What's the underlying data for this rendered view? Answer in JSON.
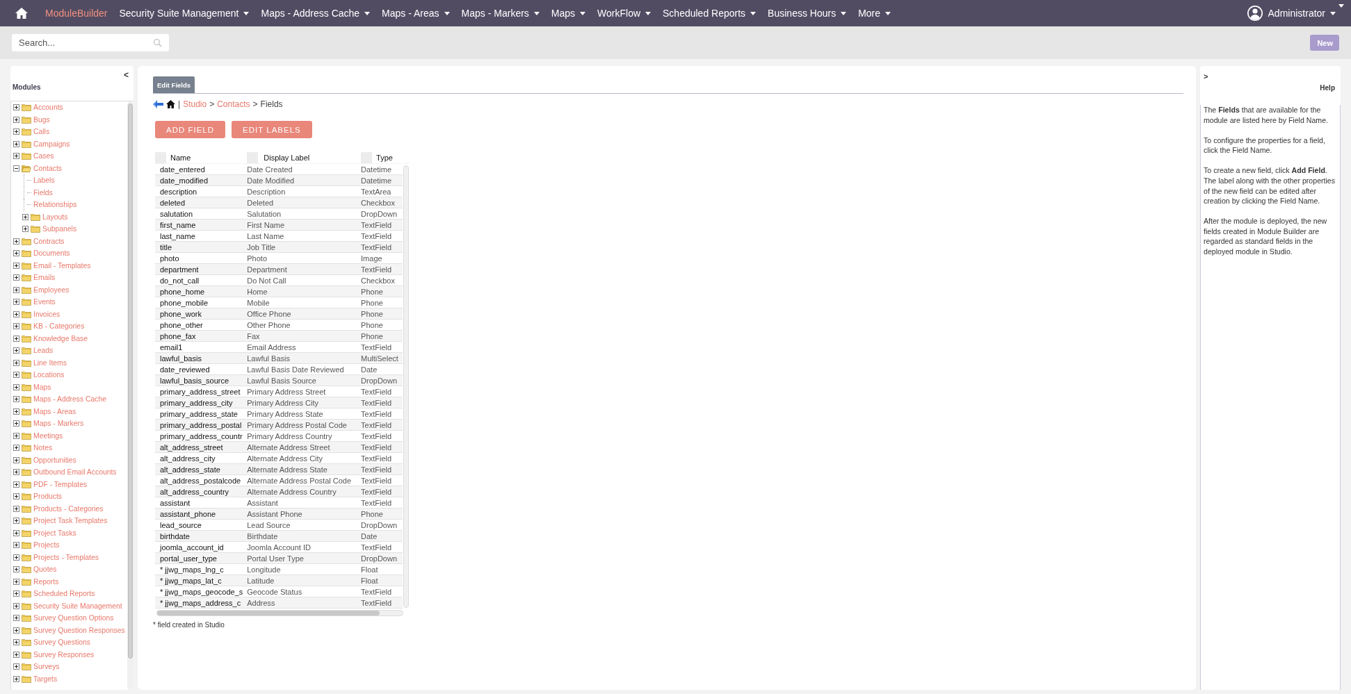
{
  "top_nav": {
    "items": [
      {
        "label": "ModuleBuilder",
        "selected": true,
        "dropdown": false
      },
      {
        "label": "Security Suite Management",
        "selected": false,
        "dropdown": true
      },
      {
        "label": "Maps - Address Cache",
        "selected": false,
        "dropdown": true
      },
      {
        "label": "Maps - Areas",
        "selected": false,
        "dropdown": true
      },
      {
        "label": "Maps - Markers",
        "selected": false,
        "dropdown": true
      },
      {
        "label": "Maps",
        "selected": false,
        "dropdown": true
      },
      {
        "label": "WorkFlow",
        "selected": false,
        "dropdown": true
      },
      {
        "label": "Scheduled Reports",
        "selected": false,
        "dropdown": true
      },
      {
        "label": "Business Hours",
        "selected": false,
        "dropdown": true
      },
      {
        "label": "More",
        "selected": false,
        "dropdown": true
      }
    ],
    "user": {
      "name": "Administrator"
    }
  },
  "search": {
    "placeholder": "Search..."
  },
  "new_button": {
    "label": "New"
  },
  "modules_panel": {
    "collapse": "<",
    "title": "Modules",
    "tree": [
      {
        "label": "Accounts",
        "kind": "folder",
        "expanded": false
      },
      {
        "label": "Bugs",
        "kind": "folder",
        "expanded": false
      },
      {
        "label": "Calls",
        "kind": "folder",
        "expanded": false
      },
      {
        "label": "Campaigns",
        "kind": "folder",
        "expanded": false
      },
      {
        "label": "Cases",
        "kind": "folder",
        "expanded": false
      },
      {
        "label": "Contacts",
        "kind": "folder",
        "expanded": true,
        "children": [
          {
            "label": "Labels",
            "kind": "leaf"
          },
          {
            "label": "Fields",
            "kind": "leaf"
          },
          {
            "label": "Relationships",
            "kind": "leaf"
          },
          {
            "label": "Layouts",
            "kind": "folder",
            "expanded": false
          },
          {
            "label": "Subpanels",
            "kind": "folder",
            "expanded": false
          }
        ]
      },
      {
        "label": "Contracts",
        "kind": "folder",
        "expanded": false
      },
      {
        "label": "Documents",
        "kind": "folder",
        "expanded": false
      },
      {
        "label": "Email - Templates",
        "kind": "folder",
        "expanded": false
      },
      {
        "label": "Emails",
        "kind": "folder",
        "expanded": false
      },
      {
        "label": "Employees",
        "kind": "folder",
        "expanded": false
      },
      {
        "label": "Events",
        "kind": "folder",
        "expanded": false
      },
      {
        "label": "Invoices",
        "kind": "folder",
        "expanded": false
      },
      {
        "label": "KB - Categories",
        "kind": "folder",
        "expanded": false
      },
      {
        "label": "Knowledge Base",
        "kind": "folder",
        "expanded": false
      },
      {
        "label": "Leads",
        "kind": "folder",
        "expanded": false
      },
      {
        "label": "Line Items",
        "kind": "folder",
        "expanded": false
      },
      {
        "label": "Locations",
        "kind": "folder",
        "expanded": false
      },
      {
        "label": "Maps",
        "kind": "folder",
        "expanded": false
      },
      {
        "label": "Maps - Address Cache",
        "kind": "folder",
        "expanded": false
      },
      {
        "label": "Maps - Areas",
        "kind": "folder",
        "expanded": false
      },
      {
        "label": "Maps - Markers",
        "kind": "folder",
        "expanded": false
      },
      {
        "label": "Meetings",
        "kind": "folder",
        "expanded": false
      },
      {
        "label": "Notes",
        "kind": "folder",
        "expanded": false
      },
      {
        "label": "Opportunities",
        "kind": "folder",
        "expanded": false
      },
      {
        "label": "Outbound Email Accounts",
        "kind": "folder",
        "expanded": false
      },
      {
        "label": "PDF - Templates",
        "kind": "folder",
        "expanded": false
      },
      {
        "label": "Products",
        "kind": "folder",
        "expanded": false
      },
      {
        "label": "Products - Categories",
        "kind": "folder",
        "expanded": false
      },
      {
        "label": "Project Task Templates",
        "kind": "folder",
        "expanded": false
      },
      {
        "label": "Project Tasks",
        "kind": "folder",
        "expanded": false
      },
      {
        "label": "Projects",
        "kind": "folder",
        "expanded": false
      },
      {
        "label": "Projects - Templates",
        "kind": "folder",
        "expanded": false
      },
      {
        "label": "Quotes",
        "kind": "folder",
        "expanded": false
      },
      {
        "label": "Reports",
        "kind": "folder",
        "expanded": false
      },
      {
        "label": "Scheduled Reports",
        "kind": "folder",
        "expanded": false
      },
      {
        "label": "Security Suite Management",
        "kind": "folder",
        "expanded": false
      },
      {
        "label": "Survey Question Options",
        "kind": "folder",
        "expanded": false
      },
      {
        "label": "Survey Question Responses",
        "kind": "folder",
        "expanded": false
      },
      {
        "label": "Survey Questions",
        "kind": "folder",
        "expanded": false
      },
      {
        "label": "Survey Responses",
        "kind": "folder",
        "expanded": false
      },
      {
        "label": "Surveys",
        "kind": "folder",
        "expanded": false
      },
      {
        "label": "Targets",
        "kind": "folder",
        "expanded": false
      }
    ]
  },
  "editor": {
    "tabs": [
      {
        "label": "Edit Fields",
        "selected": true
      }
    ],
    "breadcrumb": [
      {
        "text": "|",
        "kind": "separator"
      },
      {
        "text": "Studio",
        "kind": "link"
      },
      {
        "text": ">",
        "kind": "separator"
      },
      {
        "text": "Contacts",
        "kind": "link"
      },
      {
        "text": ">",
        "kind": "separator"
      },
      {
        "text": "Fields",
        "kind": "current"
      }
    ],
    "buttons": [
      "ADD FIELD",
      "EDIT LABELS"
    ],
    "table": {
      "columns": [
        "Name",
        "Display Label",
        "Type"
      ],
      "rows": [
        [
          "date_entered",
          "Date Created",
          "Datetime"
        ],
        [
          "date_modified",
          "Date Modified",
          "Datetime"
        ],
        [
          "description",
          "Description",
          "TextArea"
        ],
        [
          "deleted",
          "Deleted",
          "Checkbox"
        ],
        [
          "salutation",
          "Salutation",
          "DropDown"
        ],
        [
          "first_name",
          "First Name",
          "TextField"
        ],
        [
          "last_name",
          "Last Name",
          "TextField"
        ],
        [
          "title",
          "Job Title",
          "TextField"
        ],
        [
          "photo",
          "Photo",
          "Image"
        ],
        [
          "department",
          "Department",
          "TextField"
        ],
        [
          "do_not_call",
          "Do Not Call",
          "Checkbox"
        ],
        [
          "phone_home",
          "Home",
          "Phone"
        ],
        [
          "phone_mobile",
          "Mobile",
          "Phone"
        ],
        [
          "phone_work",
          "Office Phone",
          "Phone"
        ],
        [
          "phone_other",
          "Other Phone",
          "Phone"
        ],
        [
          "phone_fax",
          "Fax",
          "Phone"
        ],
        [
          "email1",
          "Email Address",
          "TextField"
        ],
        [
          "lawful_basis",
          "Lawful Basis",
          "MultiSelect"
        ],
        [
          "date_reviewed",
          "Lawful Basis Date Reviewed",
          "Date"
        ],
        [
          "lawful_basis_source",
          "Lawful Basis Source",
          "DropDown"
        ],
        [
          "primary_address_street",
          "Primary Address Street",
          "TextField"
        ],
        [
          "primary_address_city",
          "Primary Address City",
          "TextField"
        ],
        [
          "primary_address_state",
          "Primary Address State",
          "TextField"
        ],
        [
          "primary_address_postal",
          "Primary Address Postal Code",
          "TextField"
        ],
        [
          "primary_address_countr",
          "Primary Address Country",
          "TextField"
        ],
        [
          "alt_address_street",
          "Alternate Address Street",
          "TextField"
        ],
        [
          "alt_address_city",
          "Alternate Address City",
          "TextField"
        ],
        [
          "alt_address_state",
          "Alternate Address State",
          "TextField"
        ],
        [
          "alt_address_postalcode",
          "Alternate Address Postal Code",
          "TextField"
        ],
        [
          "alt_address_country",
          "Alternate Address Country",
          "TextField"
        ],
        [
          "assistant",
          "Assistant",
          "TextField"
        ],
        [
          "assistant_phone",
          "Assistant Phone",
          "Phone"
        ],
        [
          "lead_source",
          "Lead Source",
          "DropDown"
        ],
        [
          "birthdate",
          "Birthdate",
          "Date"
        ],
        [
          "joomla_account_id",
          "Joomla Account ID",
          "TextField"
        ],
        [
          "portal_user_type",
          "Portal User Type",
          "DropDown"
        ],
        [
          "* jjwg_maps_lng_c",
          "Longitude",
          "Float"
        ],
        [
          "* jjwg_maps_lat_c",
          "Latitude",
          "Float"
        ],
        [
          "* jjwg_maps_geocode_s",
          "Geocode Status",
          "TextField"
        ],
        [
          "* jjwg_maps_address_c",
          "Address",
          "TextField"
        ]
      ]
    },
    "footnote": "* field created in Studio"
  },
  "help_panel": {
    "expand": ">",
    "title": "Help",
    "paragraphs": [
      "The **Fields** that are available for the module are listed here by Field Name.",
      "To configure the properties for a field, click the Field Name.",
      "To create a new field, click **Add Field**. The label along with the other properties of the new field can be edited after creation by clicking the Field Name.",
      "After the module is deployed, the new fields created in Module Builder are regarded as standard fields in the deployed module in Studio."
    ]
  }
}
